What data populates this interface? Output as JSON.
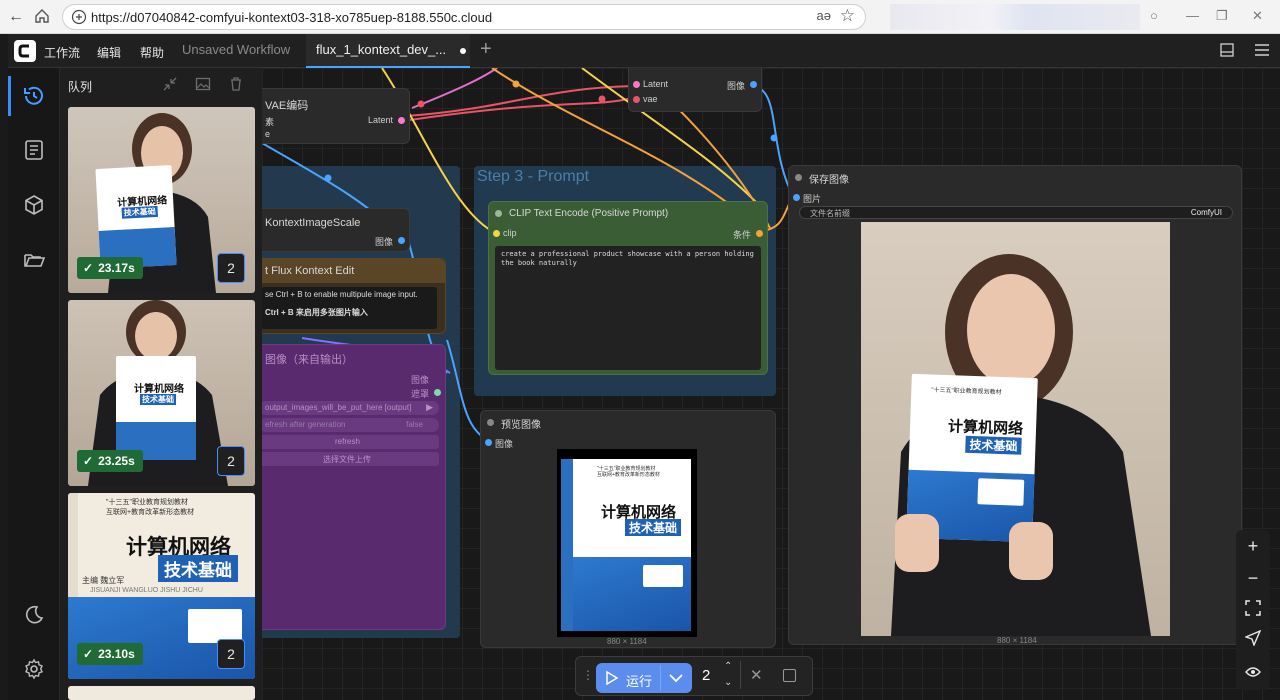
{
  "browser": {
    "url": "https://d07040842-comfyui-kontext03-318-xo785uep-8188.550c.cloud",
    "read_aloud": "aə",
    "favorite": "☆"
  },
  "app": {
    "menus": [
      "工作流",
      "编辑",
      "帮助"
    ],
    "tabs": [
      {
        "label": "Unsaved Workflow"
      },
      {
        "label": "flux_1_kontext_dev_..."
      }
    ],
    "new_tab": "+"
  },
  "queue": {
    "title": "队列",
    "items": [
      {
        "time": "23.17s",
        "count": "2"
      },
      {
        "time": "23.25s",
        "count": "2"
      },
      {
        "time": "23.10s",
        "count": "2"
      }
    ]
  },
  "book": {
    "title_line1": "计算机网络",
    "title_line2": "技术基础",
    "pinyin": "JISUANJI WANGLUO JISHU JICHU",
    "series_line1": "\"十三五\"职业教育规划教材",
    "series_line2": "互联网+教育改革新形态教材",
    "author": "主编 魏立军"
  },
  "nodes": {
    "vae_encode": {
      "title": "VAE编码",
      "out_latent": "Latent",
      "in_pixels": "素",
      "in_vae": "e"
    },
    "vae_decode": {
      "in_latent": "Latent",
      "in_vae": "vae",
      "out_image": "图像"
    },
    "scale": {
      "title": "KontextImageScale",
      "out_image": "图像"
    },
    "note": {
      "title": "t Flux Kontext Edit",
      "line1": "se Ctrl + B to enable multipule image input.",
      "line2": "Ctrl + B 来启用多张图片输入"
    },
    "load_image": {
      "title": "图像（来自输出）",
      "out_image": "图像",
      "out_mask": "遮罩",
      "file": "output_images_will_be_put_here [output]",
      "refresh_label": "efresh after generation",
      "refresh_value": "false",
      "refresh_btn": "refresh",
      "upload_btn": "选择文件上传"
    },
    "group_prompt": {
      "title": "Step 3 - Prompt"
    },
    "clip": {
      "title": "CLIP Text Encode (Positive Prompt)",
      "in_clip": "clip",
      "out_cond": "条件",
      "text": "create a professional product showcase with a person holding the book naturally"
    },
    "preview": {
      "title": "预览图像",
      "in_image": "图像",
      "size": "880 × 1184"
    },
    "save": {
      "title": "保存图像",
      "in_image": "图片",
      "prefix_label": "文件名前缀",
      "prefix_value": "ComfyUI",
      "size": "880 × 1184"
    }
  },
  "run_bar": {
    "run_label": "运行",
    "batch": "2"
  },
  "colors": {
    "accent": "#5b8def",
    "success": "#1f6a35",
    "clip_node": "#3a5d36",
    "group_blue": "#223a4f",
    "group_purple": "#5a2a6e"
  }
}
